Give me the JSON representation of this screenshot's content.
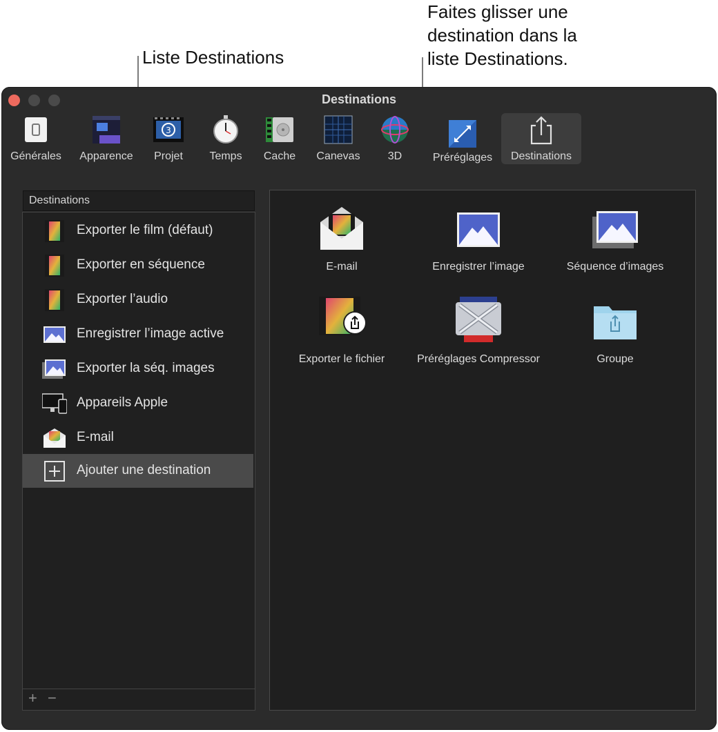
{
  "callouts": {
    "list_label": "Liste Destinations",
    "drag_line1": "Faites glisser une",
    "drag_line2": "destination dans la",
    "drag_line3": "liste Destinations."
  },
  "window": {
    "title": "Destinations"
  },
  "toolbar": {
    "items": [
      {
        "label": "Générales",
        "icon": "switch-icon"
      },
      {
        "label": "Apparence",
        "icon": "appearance-icon"
      },
      {
        "label": "Projet",
        "icon": "project-icon"
      },
      {
        "label": "Temps",
        "icon": "stopwatch-icon"
      },
      {
        "label": "Cache",
        "icon": "cache-icon"
      },
      {
        "label": "Canevas",
        "icon": "canvas-icon"
      },
      {
        "label": "3D",
        "icon": "sphere-icon"
      },
      {
        "label": "Préréglages",
        "icon": "presets-icon"
      },
      {
        "label": "Destinations",
        "icon": "share-icon",
        "selected": true
      }
    ]
  },
  "list": {
    "header": "Destinations",
    "items": [
      {
        "label": "Exporter le film (défaut)",
        "icon": "film-icon"
      },
      {
        "label": "Exporter en séquence",
        "icon": "film-icon"
      },
      {
        "label": "Exporter l’audio",
        "icon": "film-icon"
      },
      {
        "label": "Enregistrer l’image active",
        "icon": "image-icon"
      },
      {
        "label": "Exporter la séq. images",
        "icon": "image-stack-icon"
      },
      {
        "label": "Appareils Apple",
        "icon": "devices-icon"
      },
      {
        "label": "E-mail",
        "icon": "mail-icon"
      },
      {
        "label": "Ajouter une destination",
        "icon": "add-icon",
        "selected": true
      }
    ],
    "footer": {
      "add": "+",
      "remove": "−"
    }
  },
  "destinations": {
    "items": [
      {
        "label": "E-mail",
        "icon": "mail-icon"
      },
      {
        "label": "Enregistrer l’image",
        "icon": "image-icon"
      },
      {
        "label": "Séquence d’images",
        "icon": "image-stack-icon"
      },
      {
        "label": "Exporter le fichier",
        "icon": "film-share-icon"
      },
      {
        "label": "Préréglages Compressor",
        "icon": "compressor-icon"
      },
      {
        "label": "Groupe",
        "icon": "folder-share-icon"
      }
    ]
  }
}
